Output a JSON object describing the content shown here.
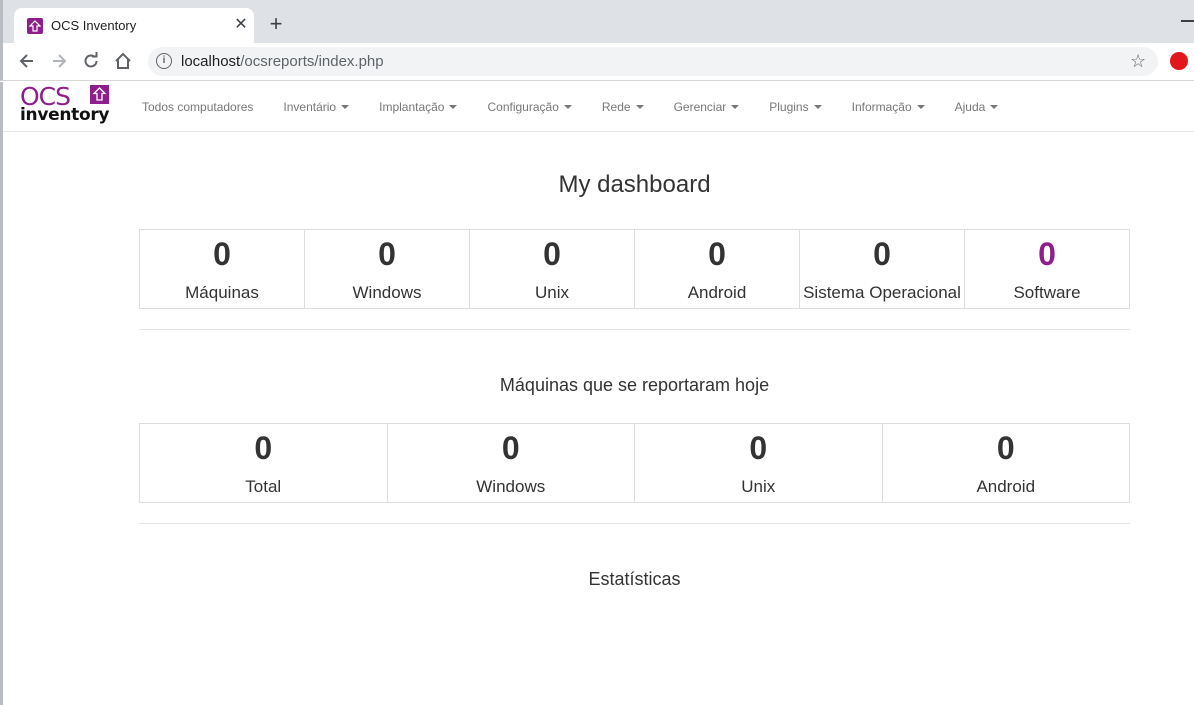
{
  "browser": {
    "tab_title": "OCS Inventory",
    "url_host": "localhost",
    "url_path": "/ocsreports/index.php"
  },
  "logo": {
    "top_text": "OCS",
    "bottom_text": "inventory",
    "brand_color": "#8e1e8b"
  },
  "menu": [
    {
      "label": "Todos computadores",
      "dropdown": false
    },
    {
      "label": "Inventário",
      "dropdown": true
    },
    {
      "label": "Implantação",
      "dropdown": true
    },
    {
      "label": "Configuração",
      "dropdown": true
    },
    {
      "label": "Rede",
      "dropdown": true
    },
    {
      "label": "Gerenciar",
      "dropdown": true
    },
    {
      "label": "Plugins",
      "dropdown": true
    },
    {
      "label": "Informação",
      "dropdown": true
    },
    {
      "label": "Ajuda",
      "dropdown": true
    }
  ],
  "dashboard": {
    "title": "My dashboard",
    "summary": [
      {
        "value": "0",
        "label": "Máquinas"
      },
      {
        "value": "0",
        "label": "Windows"
      },
      {
        "value": "0",
        "label": "Unix"
      },
      {
        "value": "0",
        "label": "Android"
      },
      {
        "value": "0",
        "label": "Sistema Operacional"
      },
      {
        "value": "0",
        "label": "Software"
      }
    ],
    "today_title": "Máquinas que se reportaram hoje",
    "today": [
      {
        "value": "0",
        "label": "Total"
      },
      {
        "value": "0",
        "label": "Windows"
      },
      {
        "value": "0",
        "label": "Unix"
      },
      {
        "value": "0",
        "label": "Android"
      }
    ],
    "stats_title": "Estatísticas"
  }
}
